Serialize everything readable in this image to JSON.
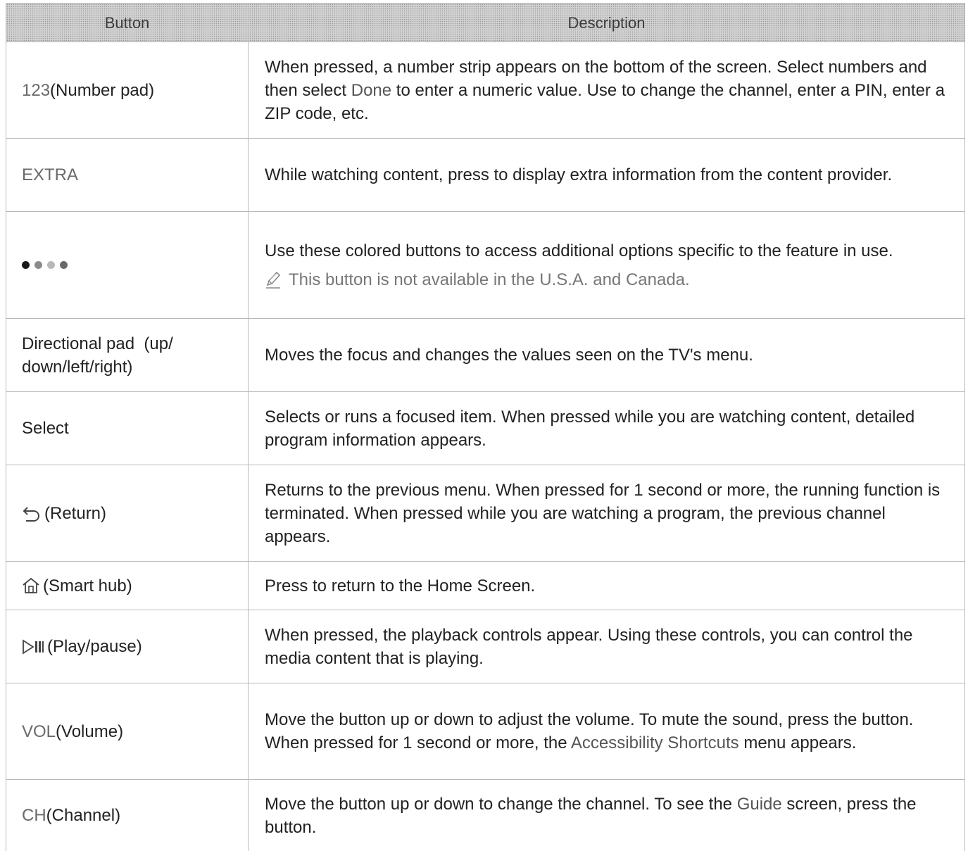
{
  "header": {
    "button": "Button",
    "description": "Description"
  },
  "rows": [
    {
      "key": "123",
      "label": " (Number pad)",
      "desc_parts": [
        "When pressed, a number strip appears on the bottom of the screen. Select numbers and then select ",
        "Done",
        " to enter a numeric value. Use to change the channel, enter a PIN, enter a ZIP code, etc."
      ]
    },
    {
      "key": "EXTRA",
      "desc": "While watching content, press to display extra information from the content provider."
    },
    {
      "dot_colors": [
        "#1a1a1a",
        "#8a8a8a",
        "#b8b8b8",
        "#6a6a6a"
      ],
      "desc": "Use these colored buttons to access additional options specific to the feature in use.",
      "note": "This button is not available in the U.S.A. and Canada."
    },
    {
      "label": "Directional pad  (up/ down/left/right)",
      "desc": "Moves the focus and changes the values seen on the TV's menu."
    },
    {
      "label": "Select",
      "desc": "Selects or runs a focused item. When pressed while you are watching content, detailed program information appears."
    },
    {
      "icon": "return-icon",
      "label": "(Return)",
      "desc": "Returns to the previous menu. When pressed for 1 second or more, the running function is terminated. When pressed while you are watching a program, the previous channel appears."
    },
    {
      "icon": "home-icon",
      "label": "(Smart hub)",
      "desc": "Press to return to the Home Screen."
    },
    {
      "icon": "play-pause-icon",
      "label": "(Play/pause)",
      "desc": "When pressed, the playback controls appear. Using these controls, you can control the media content that is playing."
    },
    {
      "key": "VOL",
      "label": " (Volume)",
      "desc_parts": [
        "Move the button up or down to adjust the volume. To mute the sound, press the button. When pressed for 1 second or more, the ",
        "Accessibility Shortcuts",
        " menu appears."
      ]
    },
    {
      "key": "CH",
      "label": " (Channel)",
      "desc_parts": [
        "Move the button up or down to change the channel. To see the ",
        "Guide",
        " screen, press the button."
      ]
    }
  ]
}
